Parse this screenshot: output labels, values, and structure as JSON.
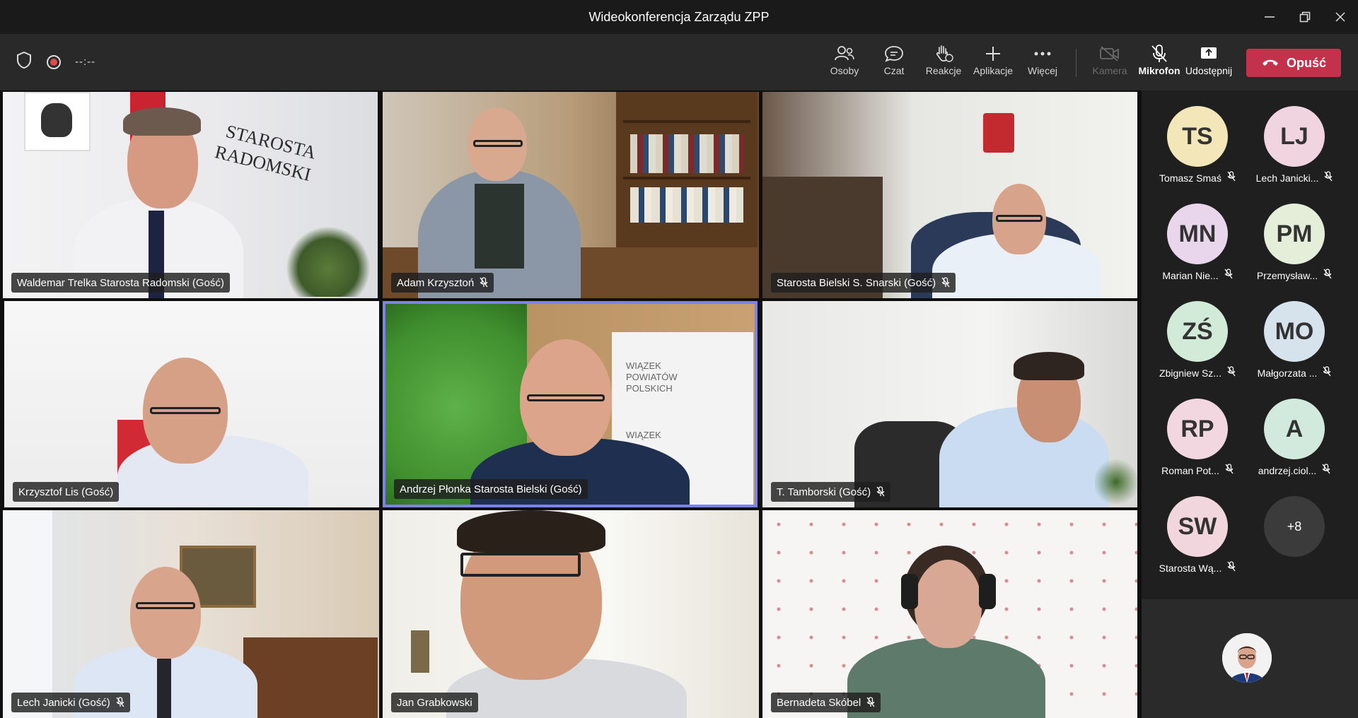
{
  "window": {
    "title": "Wideokonferencja Zarządu ZPP"
  },
  "status": {
    "timer": "--:--"
  },
  "toolbar": {
    "people_label": "Osoby",
    "chat_label": "Czat",
    "reactions_label": "Reakcje",
    "apps_label": "Aplikacje",
    "more_label": "Więcej",
    "camera_label": "Kamera",
    "mic_label": "Mikrofon",
    "share_label": "Udostępnij",
    "leave_label": "Opuść"
  },
  "tiles": [
    {
      "name": "Waldemar Trelka Starosta Radomski (Gość)",
      "muted": false
    },
    {
      "name": "Adam Krzysztoń",
      "muted": true
    },
    {
      "name": "Starosta Bielski S. Snarski (Gość)",
      "muted": true
    },
    {
      "name": "Krzysztof Lis (Gość)",
      "muted": false
    },
    {
      "name": "Andrzej Płonka Starosta Bielski (Gość)",
      "muted": false
    },
    {
      "name": "T. Tamborski (Gość)",
      "muted": true
    },
    {
      "name": "Lech Janicki (Gość)",
      "muted": true
    },
    {
      "name": "Jan Grabkowski",
      "muted": false
    },
    {
      "name": "Bernadeta Skóbel",
      "muted": true
    }
  ],
  "wall_text": {
    "line1": "STAROSTA",
    "line2": "RADOMSKI"
  },
  "banner_text": {
    "line1": "WIĄZEK",
    "line2": "POWIATÓW",
    "line3": "POLSKICH",
    "line4": "WIĄZEK"
  },
  "roster": [
    {
      "initials": "TS",
      "name": "Tomasz Smaś",
      "color": "#f3e6b9"
    },
    {
      "initials": "LJ",
      "name": "Lech Janicki...",
      "color": "#f0d4df"
    },
    {
      "initials": "MN",
      "name": "Marian Nie...",
      "color": "#ead6ec"
    },
    {
      "initials": "PM",
      "name": "Przemysław...",
      "color": "#e4eed9"
    },
    {
      "initials": "ZŚ",
      "name": "Zbigniew Sz...",
      "color": "#d2ead8"
    },
    {
      "initials": "MO",
      "name": "Małgorzata ...",
      "color": "#d6e2ec"
    },
    {
      "initials": "RP",
      "name": "Roman Pot...",
      "color": "#f2d6e0"
    },
    {
      "initials": "A",
      "name": "andrzej.ciol...",
      "color": "#d2eade"
    },
    {
      "initials": "SW",
      "name": "Starosta Wą...",
      "color": "#f2d6de"
    }
  ],
  "overflow": {
    "label": "+8"
  },
  "colors": {
    "accent": "#7b83eb",
    "leave": "#c4314b",
    "record": "#e34b4b"
  }
}
